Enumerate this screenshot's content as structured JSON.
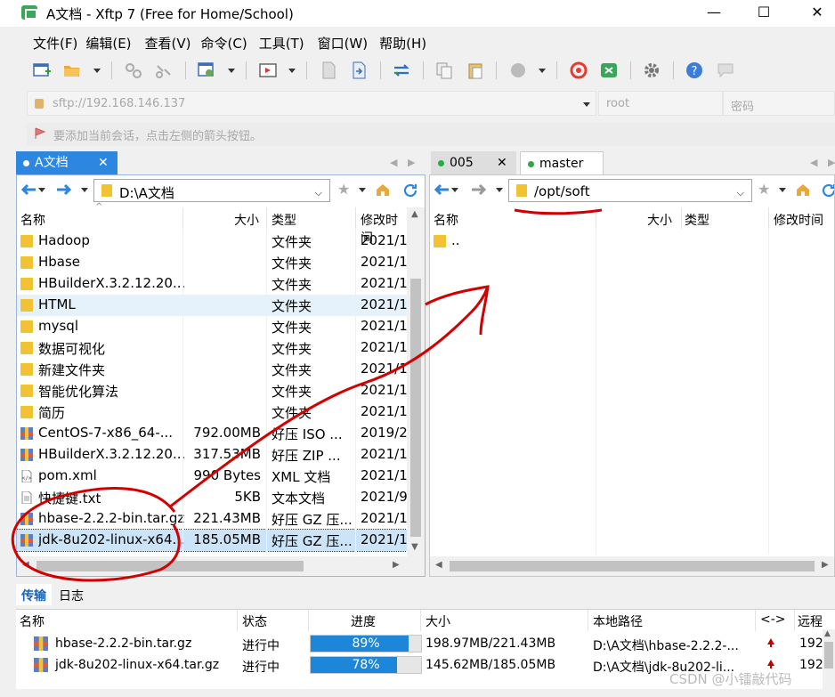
{
  "window": {
    "title": "A文档 - Xftp 7 (Free for Home/School)",
    "minimize": "—",
    "maximize": "☐",
    "close": "✕"
  },
  "menu": [
    "文件(F)",
    "编辑(E)",
    "查看(V)",
    "命令(C)",
    "工具(T)",
    "窗口(W)",
    "帮助(H)"
  ],
  "address": {
    "url_placeholder": "sftp://192.168.146.137",
    "user_placeholder": "root",
    "password_placeholder": "密码"
  },
  "hint": "要添加当前会话，点击左侧的箭头按钮。",
  "left": {
    "tab_label": "A文档",
    "tab_close": "✕",
    "path": "D:\\A文档",
    "columns": {
      "name": "名称",
      "size": "大小",
      "type": "类型",
      "modified": "修改时间"
    },
    "rows": [
      {
        "name": "Hadoop",
        "size": "",
        "type": "文件夹",
        "modified": "2021/1",
        "icon": "folder"
      },
      {
        "name": "Hbase",
        "size": "",
        "type": "文件夹",
        "modified": "2021/1",
        "icon": "folder"
      },
      {
        "name": "HBuilderX.3.2.12.20...",
        "size": "",
        "type": "文件夹",
        "modified": "2021/1",
        "icon": "folder"
      },
      {
        "name": "HTML",
        "size": "",
        "type": "文件夹",
        "modified": "2021/1",
        "icon": "folder"
      },
      {
        "name": "mysql",
        "size": "",
        "type": "文件夹",
        "modified": "2021/1",
        "icon": "folder"
      },
      {
        "name": "数据可视化",
        "size": "",
        "type": "文件夹",
        "modified": "2021/1",
        "icon": "folder"
      },
      {
        "name": "新建文件夹",
        "size": "",
        "type": "文件夹",
        "modified": "2021/1",
        "icon": "folder"
      },
      {
        "name": "智能优化算法",
        "size": "",
        "type": "文件夹",
        "modified": "2021/1",
        "icon": "folder"
      },
      {
        "name": "简历",
        "size": "",
        "type": "文件夹",
        "modified": "2021/1",
        "icon": "folder"
      },
      {
        "name": "CentOS-7-x86_64-...",
        "size": "792.00MB",
        "type": "好压 ISO ...",
        "modified": "2019/2",
        "icon": "archive"
      },
      {
        "name": "HBuilderX.3.2.12.20...",
        "size": "317.53MB",
        "type": "好压 ZIP ...",
        "modified": "2021/1",
        "icon": "archive"
      },
      {
        "name": "pom.xml",
        "size": "990 Bytes",
        "type": "XML 文档",
        "modified": "2021/1",
        "icon": "xml"
      },
      {
        "name": "快捷键.txt",
        "size": "5KB",
        "type": "文本文档",
        "modified": "2021/9",
        "icon": "text"
      },
      {
        "name": "hbase-2.2.2-bin.tar.gz",
        "size": "221.43MB",
        "type": "好压 GZ 压...",
        "modified": "2021/1",
        "icon": "archive"
      },
      {
        "name": "jdk-8u202-linux-x64...",
        "size": "185.05MB",
        "type": "好压 GZ 压...",
        "modified": "2021/1",
        "icon": "archive"
      }
    ]
  },
  "right": {
    "tab1_label": "005",
    "tab1_close": "✕",
    "tab2_label": "master",
    "path": "/opt/soft",
    "columns": {
      "name": "名称",
      "size": "大小",
      "type": "类型",
      "modified": "修改时间"
    },
    "rows": [
      {
        "name": "..",
        "icon": "folder"
      }
    ]
  },
  "bottom": {
    "tab_transfer": "传输",
    "tab_log": "日志",
    "columns": {
      "name": "名称",
      "status": "状态",
      "progress": "进度",
      "size": "大小",
      "local": "本地路径",
      "dir": "<->",
      "remote": "远程"
    },
    "rows": [
      {
        "name": "hbase-2.2.2-bin.tar.gz",
        "status": "进行中",
        "progress": 0.89,
        "progress_label": "89%",
        "size": "198.97MB/221.43MB",
        "local": "D:\\A文档\\hbase-2.2.2-...",
        "remote": "192."
      },
      {
        "name": "jdk-8u202-linux-x64.tar.gz",
        "status": "进行中",
        "progress": 0.78,
        "progress_label": "78%",
        "size": "145.62MB/185.05MB",
        "local": "D:\\A文档\\jdk-8u202-li...",
        "remote": "192."
      }
    ]
  },
  "watermark": "CSDN @小镭敲代码",
  "colors": {
    "accent": "#0078d7",
    "selected_row": "#cce4f7",
    "progress": "#1e86d8",
    "annotation": "#d40000"
  }
}
